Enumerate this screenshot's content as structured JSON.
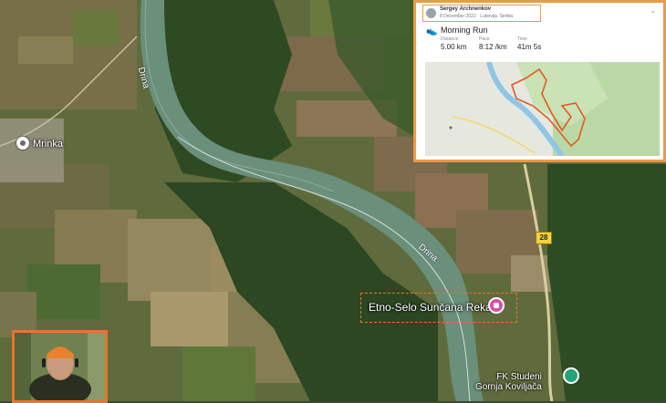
{
  "map": {
    "place_label": "Mrinka",
    "river_labels": [
      "Drina",
      "Drina"
    ],
    "poi_label": "Etno-Selo Sunčana Reka",
    "road_number": "28",
    "fk_label": "FK Studeni\nGornja Koviljača"
  },
  "card": {
    "athlete_name": "Sergey Archnenkov",
    "meta": "8 December 2022 · Lubovija, Serbia",
    "activity_title": "Morning Run",
    "stats": [
      {
        "label": "Distance",
        "value": "5.00 km"
      },
      {
        "label": "Pace",
        "value": "8:12 /km"
      },
      {
        "label": "Time",
        "value": "41m 5s"
      }
    ]
  },
  "colors": {
    "highlight": "#e6762b",
    "poi_pin": "#d94fa6",
    "route": "#e25a22"
  }
}
